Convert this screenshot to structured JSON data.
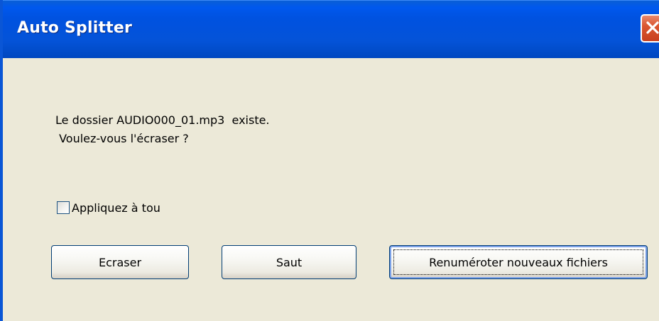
{
  "window": {
    "title": "Auto Splitter",
    "close_icon": "close-icon"
  },
  "message": {
    "line1": "Le dossier AUDIO000_01.mp3  existe.",
    "line2": " Voulez-vous l'écraser ?"
  },
  "options": {
    "apply_all_label": "Appliquez à tou",
    "apply_all_checked": false
  },
  "buttons": {
    "overwrite_label": "Ecraser",
    "skip_label": "Saut",
    "rename_label": "Renuméroter nouveaux fichiers"
  },
  "colors": {
    "titlebar": "#0453D8",
    "dialog_bg": "#ECE9D8",
    "close_button": "#DA5631"
  }
}
